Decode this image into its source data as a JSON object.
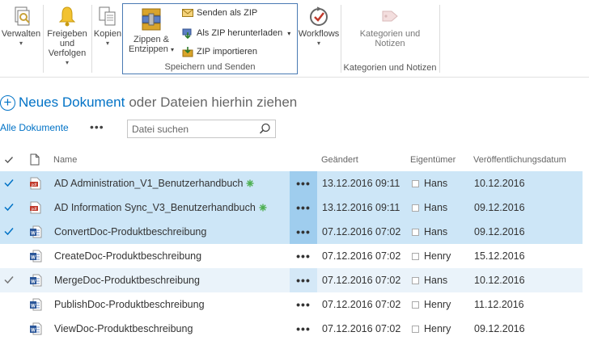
{
  "ribbon": {
    "verwalten": "Verwalten",
    "freigeben": "Freigeben und Verfolgen",
    "kopien": "Kopien",
    "zippen": "Zippen & Entzippen",
    "senden_zip": "Senden als ZIP",
    "zip_herunterladen": "Als ZIP herunterladen",
    "zip_importieren": "ZIP importieren",
    "group_speichern": "Speichern und Senden",
    "workflows": "Workflows",
    "kategorien": "Kategorien und Notizen",
    "group_kategorien": "Kategorien und Notizen"
  },
  "commands": {
    "new_doc_link": "Neues Dokument",
    "new_doc_rest": "oder Dateien hierhin ziehen",
    "view_name": "Alle Dokumente",
    "view_more": "•••",
    "search_placeholder": "Datei suchen"
  },
  "columns": {
    "name": "Name",
    "geaendert": "Geändert",
    "eigentuemer": "Eigentümer",
    "veroeffentlichung": "Veröffentlichungsdatum"
  },
  "rows": [
    {
      "name": "AD Administration_V1_Benutzerhandbuch",
      "type": "pdf",
      "new": true,
      "modified": "13.12.2016 09:11",
      "owner": "Hans",
      "published": "10.12.2016",
      "state": "selected"
    },
    {
      "name": "AD Information Sync_V3_Benutzerhandbuch",
      "type": "pdf",
      "new": true,
      "modified": "13.12.2016 09:11",
      "owner": "Hans",
      "published": "09.12.2016",
      "state": "selected"
    },
    {
      "name": "ConvertDoc-Produktbeschreibung",
      "type": "word",
      "new": false,
      "modified": "07.12.2016 07:02",
      "owner": "Hans",
      "published": "09.12.2016",
      "state": "selected"
    },
    {
      "name": "CreateDoc-Produktbeschreibung",
      "type": "word",
      "new": false,
      "modified": "07.12.2016 07:02",
      "owner": "Henry",
      "published": "15.12.2016",
      "state": "normal"
    },
    {
      "name": "MergeDoc-Produktbeschreibung",
      "type": "word",
      "new": false,
      "modified": "07.12.2016 07:02",
      "owner": "Hans",
      "published": "10.12.2016",
      "state": "hover"
    },
    {
      "name": "PublishDoc-Produktbeschreibung",
      "type": "word",
      "new": false,
      "modified": "07.12.2016 07:02",
      "owner": "Henry",
      "published": "11.12.2016",
      "state": "normal"
    },
    {
      "name": "ViewDoc-Produktbeschreibung",
      "type": "word",
      "new": false,
      "modified": "07.12.2016 07:02",
      "owner": "Henry",
      "published": "09.12.2016",
      "state": "normal"
    }
  ],
  "colors": {
    "accent": "#0072c6",
    "selected_row": "#cde6f7",
    "hover_row": "#eaf3fa",
    "group_border": "#4a7ab3"
  }
}
